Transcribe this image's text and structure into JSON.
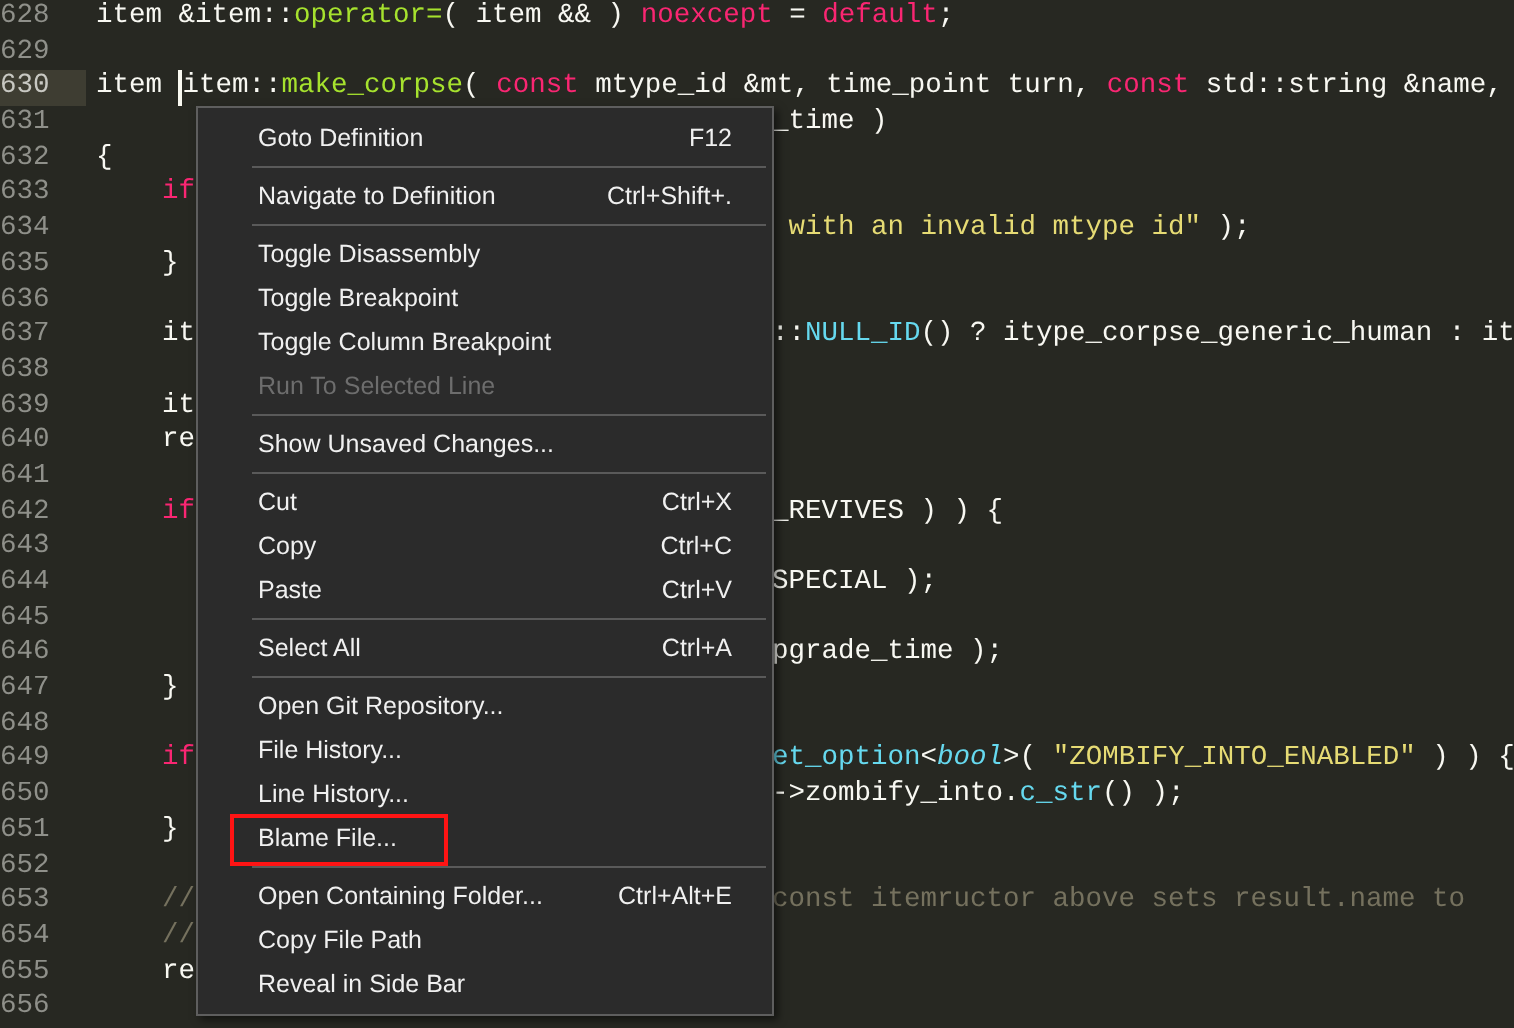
{
  "editor": {
    "lines": [
      {
        "number": "628",
        "current": false,
        "left": [
          {
            "kind": "plain",
            "text": "item &item::"
          },
          {
            "kind": "function",
            "text": "operator="
          },
          {
            "kind": "plain",
            "text": "( item && ) "
          },
          {
            "kind": "keyword",
            "text": "noexcept"
          },
          {
            "kind": "plain",
            "text": " = "
          },
          {
            "kind": "keyword",
            "text": "default"
          },
          {
            "kind": "plain",
            "text": ";"
          }
        ]
      },
      {
        "number": "629",
        "current": false
      },
      {
        "number": "630",
        "current": true,
        "left": [
          {
            "kind": "plain",
            "text": "item "
          },
          {
            "kind": "plain",
            "text": "item::",
            "caret": true
          },
          {
            "kind": "function",
            "text": "make_corpse"
          },
          {
            "kind": "plain",
            "text": "( "
          },
          {
            "kind": "keyword",
            "text": "const"
          },
          {
            "kind": "plain",
            "text": " mtype_id &mt, time_point turn, "
          },
          {
            "kind": "keyword",
            "text": "const"
          },
          {
            "kind": "plain",
            "text": " std::string &name,"
          }
        ]
      },
      {
        "number": "631",
        "current": false,
        "right": [
          {
            "kind": "plain",
            "text": "_time )"
          }
        ]
      },
      {
        "number": "632",
        "current": false,
        "left": [
          {
            "kind": "plain",
            "text": "{"
          }
        ]
      },
      {
        "number": "633",
        "current": false,
        "left": [
          {
            "kind": "keyword",
            "text": "    if"
          }
        ]
      },
      {
        "number": "634",
        "current": false,
        "right": [
          {
            "kind": "string",
            "text": " with an invalid mtype id\""
          },
          {
            "kind": "plain",
            "text": " );"
          }
        ]
      },
      {
        "number": "635",
        "current": false,
        "left": [
          {
            "kind": "plain",
            "text": "    }"
          }
        ]
      },
      {
        "number": "636",
        "current": false
      },
      {
        "number": "637",
        "current": false,
        "left": [
          {
            "kind": "plain",
            "text": "    it"
          }
        ],
        "right": [
          {
            "kind": "plain",
            "text": "::"
          },
          {
            "kind": "support",
            "text": "NULL_ID"
          },
          {
            "kind": "plain",
            "text": "() ? itype_corpse_generic_human : it"
          }
        ]
      },
      {
        "number": "638",
        "current": false
      },
      {
        "number": "639",
        "current": false,
        "left": [
          {
            "kind": "plain",
            "text": "    it"
          }
        ]
      },
      {
        "number": "640",
        "current": false,
        "left": [
          {
            "kind": "plain",
            "text": "    re"
          }
        ]
      },
      {
        "number": "641",
        "current": false
      },
      {
        "number": "642",
        "current": false,
        "left": [
          {
            "kind": "keyword",
            "text": "    if"
          }
        ],
        "right": [
          {
            "kind": "plain",
            "text": "_REVIVES ) ) {"
          }
        ]
      },
      {
        "number": "643",
        "current": false
      },
      {
        "number": "644",
        "current": false,
        "right": [
          {
            "kind": "plain",
            "text": "SPECIAL );"
          }
        ]
      },
      {
        "number": "645",
        "current": false
      },
      {
        "number": "646",
        "current": false,
        "right": [
          {
            "kind": "plain",
            "text": "pgrade_time );"
          }
        ]
      },
      {
        "number": "647",
        "current": false,
        "left": [
          {
            "kind": "plain",
            "text": "    }"
          }
        ]
      },
      {
        "number": "648",
        "current": false
      },
      {
        "number": "649",
        "current": false,
        "left": [
          {
            "kind": "keyword",
            "text": "    if"
          }
        ],
        "right": [
          {
            "kind": "support",
            "text": "et_option"
          },
          {
            "kind": "plain",
            "text": "<"
          },
          {
            "kind": "type",
            "text": "bool"
          },
          {
            "kind": "plain",
            "text": ">( "
          },
          {
            "kind": "string",
            "text": "\"ZOMBIFY_INTO_ENABLED\""
          },
          {
            "kind": "plain",
            "text": " ) ) {"
          }
        ]
      },
      {
        "number": "650",
        "current": false,
        "right": [
          {
            "kind": "plain",
            "text": "->zombify_into."
          },
          {
            "kind": "support",
            "text": "c_str"
          },
          {
            "kind": "plain",
            "text": "() );"
          }
        ]
      },
      {
        "number": "651",
        "current": false,
        "left": [
          {
            "kind": "plain",
            "text": "    }"
          }
        ]
      },
      {
        "number": "652",
        "current": false
      },
      {
        "number": "653",
        "current": false,
        "left": [
          {
            "kind": "comment",
            "text": "    //"
          }
        ],
        "right": [
          {
            "kind": "comment",
            "text": "const itemructor above sets result.name to"
          }
        ]
      },
      {
        "number": "654",
        "current": false,
        "left": [
          {
            "kind": "comment",
            "text": "    //"
          }
        ]
      },
      {
        "number": "655",
        "current": false,
        "left": [
          {
            "kind": "plain",
            "text": "    re"
          }
        ]
      },
      {
        "number": "656",
        "current": false
      }
    ]
  },
  "context_menu": {
    "items": [
      {
        "kind": "item",
        "label": "Goto Definition",
        "shortcut": "F12",
        "disabled": false,
        "outlined": false
      },
      {
        "kind": "separator"
      },
      {
        "kind": "item",
        "label": "Navigate to Definition",
        "shortcut": "Ctrl+Shift+.",
        "disabled": false,
        "outlined": false
      },
      {
        "kind": "separator"
      },
      {
        "kind": "item",
        "label": "Toggle Disassembly",
        "disabled": false,
        "outlined": false
      },
      {
        "kind": "item",
        "label": "Toggle Breakpoint",
        "disabled": false,
        "outlined": false
      },
      {
        "kind": "item",
        "label": "Toggle Column Breakpoint",
        "disabled": false,
        "outlined": false
      },
      {
        "kind": "item",
        "label": "Run To Selected Line",
        "disabled": true,
        "outlined": false
      },
      {
        "kind": "separator"
      },
      {
        "kind": "item",
        "label": "Show Unsaved Changes...",
        "disabled": false,
        "outlined": false
      },
      {
        "kind": "separator"
      },
      {
        "kind": "item",
        "label": "Cut",
        "shortcut": "Ctrl+X",
        "disabled": false,
        "outlined": false
      },
      {
        "kind": "item",
        "label": "Copy",
        "shortcut": "Ctrl+C",
        "disabled": false,
        "outlined": false
      },
      {
        "kind": "item",
        "label": "Paste",
        "shortcut": "Ctrl+V",
        "disabled": false,
        "outlined": false
      },
      {
        "kind": "separator"
      },
      {
        "kind": "item",
        "label": "Select All",
        "shortcut": "Ctrl+A",
        "disabled": false,
        "outlined": false
      },
      {
        "kind": "separator"
      },
      {
        "kind": "item",
        "label": "Open Git Repository...",
        "disabled": false,
        "outlined": false
      },
      {
        "kind": "item",
        "label": "File History...",
        "disabled": false,
        "outlined": false
      },
      {
        "kind": "item",
        "label": "Line History...",
        "disabled": false,
        "outlined": false
      },
      {
        "kind": "item",
        "label": "Blame File...",
        "disabled": false,
        "outlined": true
      },
      {
        "kind": "separator"
      },
      {
        "kind": "item",
        "label": "Open Containing Folder...",
        "shortcut": "Ctrl+Alt+E",
        "disabled": false,
        "outlined": false
      },
      {
        "kind": "item",
        "label": "Copy File Path",
        "disabled": false,
        "outlined": false
      },
      {
        "kind": "item",
        "label": "Reveal in Side Bar",
        "disabled": false,
        "outlined": false
      }
    ]
  }
}
